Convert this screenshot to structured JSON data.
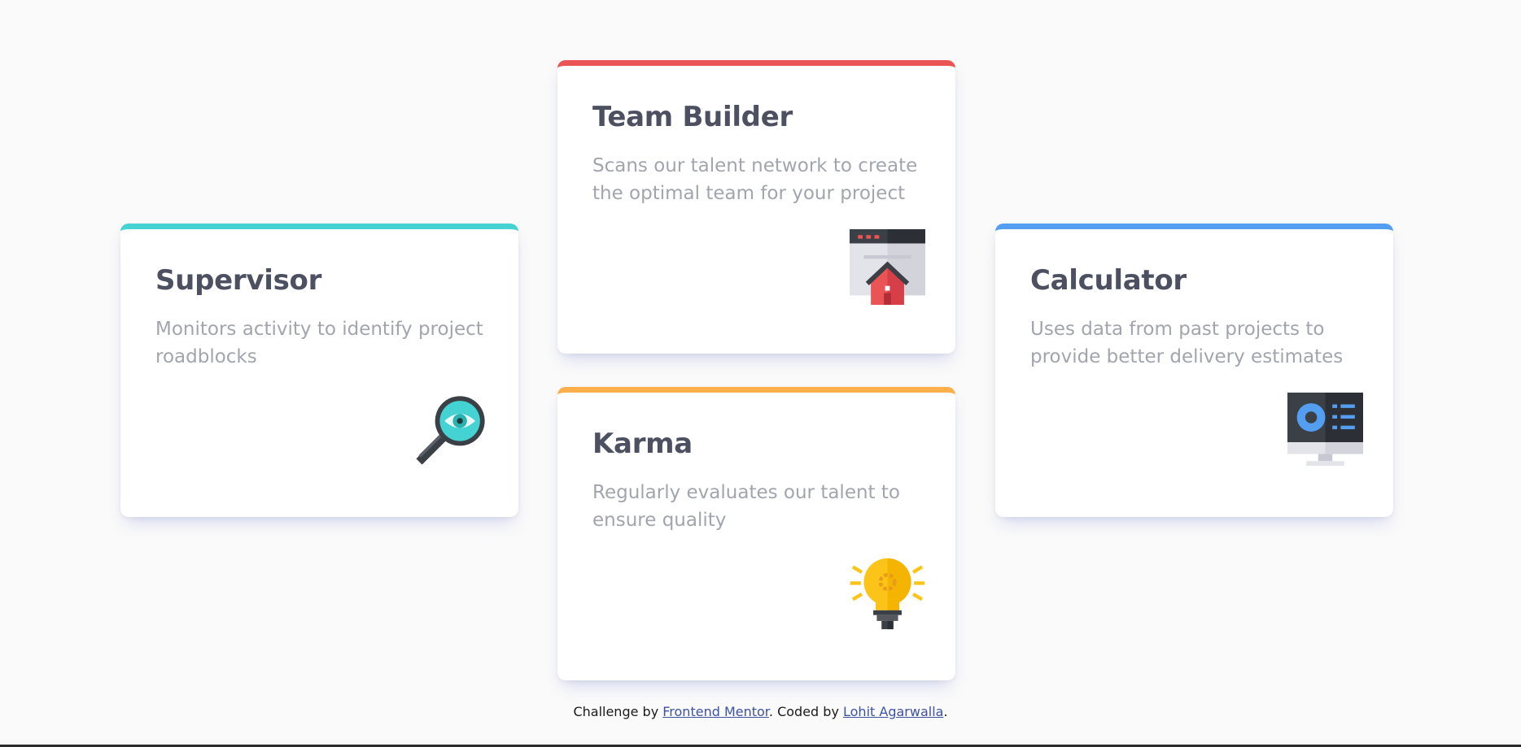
{
  "cards": {
    "supervisor": {
      "title": "Supervisor",
      "description": "Monitors activity to identify project roadblocks",
      "accent": "#44d3d2",
      "icon": "magnifier-eye-icon"
    },
    "team_builder": {
      "title": "Team Builder",
      "description": "Scans our talent network to create the optimal team for your project",
      "accent": "#ea5454",
      "icon": "browser-house-icon"
    },
    "karma": {
      "title": "Karma",
      "description": "Regularly evaluates our talent to ensure quality",
      "accent": "#fcaf4a",
      "icon": "lightbulb-icon"
    },
    "calculator": {
      "title": "Calculator",
      "description": "Uses data from past projects to provide better delivery estimates",
      "accent": "#549ef2",
      "icon": "monitor-dashboard-icon"
    }
  },
  "footer": {
    "prefix": "Challenge by ",
    "challenge_link": "Frontend Mentor",
    "middle": ". Coded by ",
    "author_link": "Lohit Agarwalla",
    "suffix": "."
  }
}
